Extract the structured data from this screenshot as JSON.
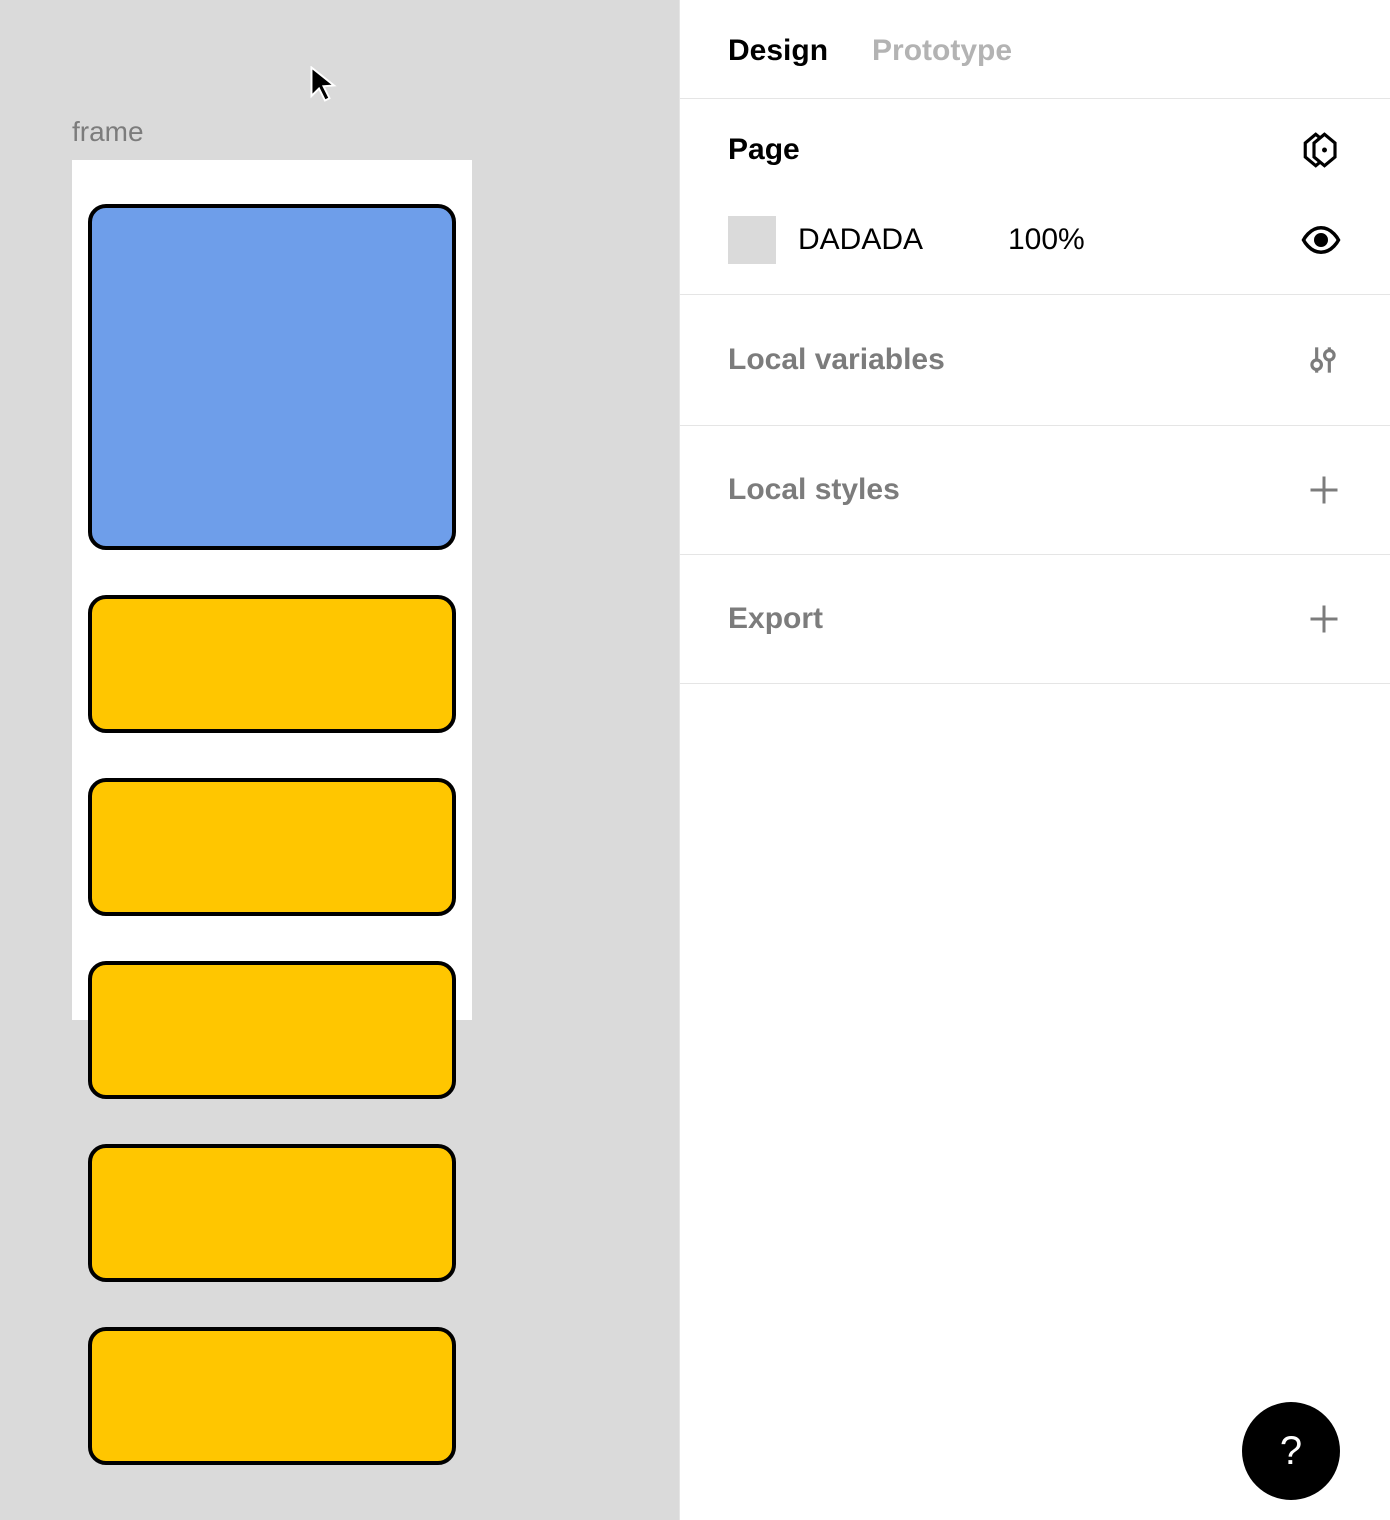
{
  "canvas": {
    "frame_label": "frame",
    "shapes": [
      {
        "kind": "blue"
      },
      {
        "kind": "yellow"
      },
      {
        "kind": "yellow"
      },
      {
        "kind": "yellow"
      },
      {
        "kind": "yellow"
      },
      {
        "kind": "yellow"
      }
    ]
  },
  "tabs": {
    "design": "Design",
    "prototype": "Prototype",
    "active": "design"
  },
  "page_section": {
    "title": "Page",
    "fill_hex": "DADADA",
    "fill_swatch": "#dadada",
    "opacity": "100%"
  },
  "sections": {
    "local_variables": "Local variables",
    "local_styles": "Local styles",
    "export": "Export"
  },
  "help_label": "?"
}
